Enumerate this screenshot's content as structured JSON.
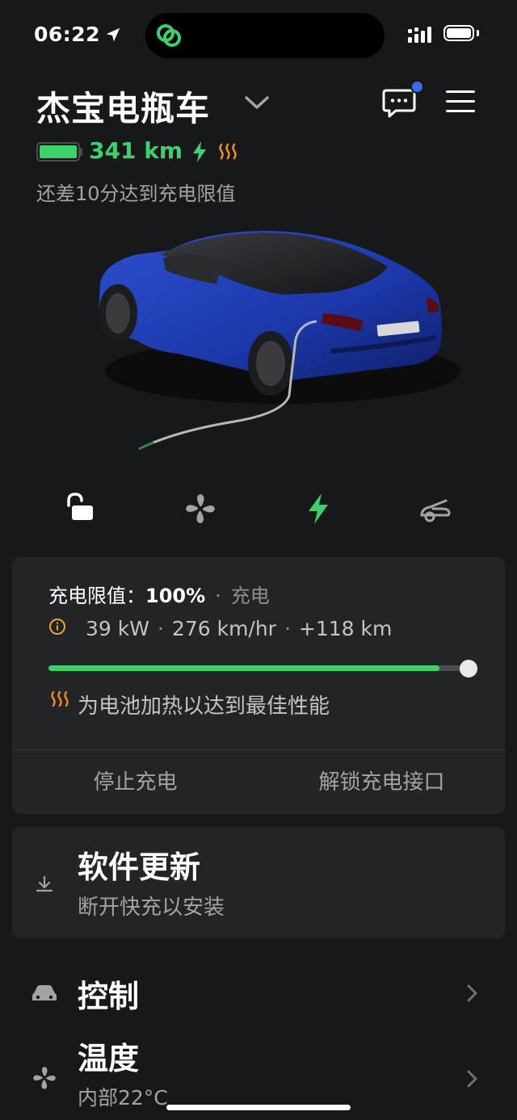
{
  "status_bar": {
    "time": "06:22"
  },
  "header": {
    "vehicle_name": "杰宝电瓶车",
    "range": "341 km",
    "charge_status": "还差10分达到充电限值"
  },
  "charge_card": {
    "limit_label": "充电限值：",
    "limit_value": "100%",
    "separator": "·",
    "mode": "充电",
    "power": "39 kW",
    "rate": "276 km/hr",
    "added": "+118 km",
    "charge_level_percent": 93,
    "heat_message": "为电池加热以达到最佳性能",
    "stop_label": "停止充电",
    "unlock_label": "解锁充电接口"
  },
  "software": {
    "title": "软件更新",
    "subtitle": "断开快充以安装"
  },
  "menu": {
    "controls": "控制",
    "climate": "温度",
    "climate_sub": "内部22°C"
  },
  "colors": {
    "accent_green": "#3ed06b",
    "heat_orange": "#f08a24",
    "notify_blue": "#3e6ae1",
    "card_bg": "#232427",
    "page_bg": "#17181a"
  },
  "icons": {
    "lock": "unlock-icon",
    "climate": "fan-icon",
    "charge": "bolt-icon",
    "frunk": "frunk-icon"
  }
}
